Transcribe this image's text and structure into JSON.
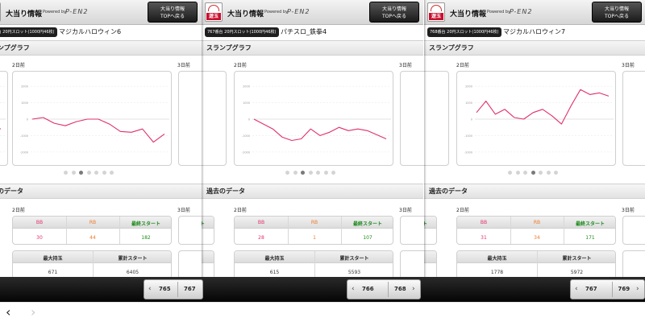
{
  "panels": [
    {
      "machine_badge": "766番台 20円スロット(1000円46枚)",
      "machine_name": "マジカルハロウィン6",
      "days": [
        "2日前",
        "3日前"
      ],
      "table1": {
        "headers": [
          "BB",
          "RB",
          "最終スタート"
        ],
        "values": [
          "30",
          "44",
          "182"
        ]
      },
      "table2": {
        "headers": [
          "最大持玉",
          "累計スタート"
        ],
        "values": [
          "671",
          "6405"
        ]
      },
      "pager": {
        "prev": "765",
        "next": "767"
      },
      "left_clip_start": "ート",
      "active_dot": 2
    },
    {
      "machine_badge": "767番台 20円スロット(1000円46枚)",
      "machine_name": "パチスロ_鉄拳4",
      "days": [
        "2日前",
        "3日前"
      ],
      "table1": {
        "headers": [
          "BB",
          "RB",
          "最終スタート"
        ],
        "values": [
          "28",
          "1",
          "107"
        ]
      },
      "table2": {
        "headers": [
          "最大持玉",
          "累計スタート"
        ],
        "values": [
          "615",
          "5593"
        ]
      },
      "pager": {
        "prev": "766",
        "next": "768"
      },
      "left_clip_start": "ート",
      "active_dot": 2
    },
    {
      "machine_badge": "768番台 20円スロット(1000円46枚)",
      "machine_name": "マジカルハロウィン7",
      "days": [
        "2日前",
        "3日前"
      ],
      "table1": {
        "headers": [
          "BB",
          "RB",
          "最終スタート"
        ],
        "values": [
          "31",
          "34",
          "171"
        ]
      },
      "table2": {
        "headers": [
          "最大持玉",
          "累計スタート"
        ],
        "values": [
          "1778",
          "5972"
        ]
      },
      "pager": {
        "prev": "767",
        "next": "769"
      },
      "left_clip_start": "ート",
      "active_dot": 3
    }
  ],
  "header": {
    "title": "大当り情報",
    "powered": "Powered by",
    "brand": "P-EN2",
    "top_button": "大当り情報\nTOPへ戻る",
    "logo_text": "遊玉"
  },
  "sections": {
    "graph": "スランプグラフ",
    "past": "過去のデータ"
  },
  "graph_axis": [
    "2000",
    "1000",
    "0",
    "-1000",
    "-2000"
  ],
  "colors": {
    "line": "#e0306a",
    "start": "#1a8a1a",
    "rb": "#f07a2a"
  },
  "nav": {
    "back": "‹",
    "forward": "›"
  },
  "chart_data": [
    {
      "type": "line",
      "title": "",
      "xlabel": "",
      "ylabel": "",
      "ylim": [
        -2500,
        2500
      ],
      "series": [
        {
          "values": [
            0,
            100,
            -250,
            -400,
            -150,
            0,
            0,
            -300,
            -750,
            -800,
            -600,
            -1400,
            -900
          ]
        }
      ]
    },
    {
      "type": "line",
      "title": "",
      "xlabel": "",
      "ylabel": "",
      "ylim": [
        -2500,
        2500
      ],
      "series": [
        {
          "values": [
            0,
            -300,
            -600,
            -1100,
            -1300,
            -1200,
            -600,
            -1000,
            -800,
            -500,
            -700,
            -600,
            -700,
            -950,
            -1200
          ]
        }
      ]
    },
    {
      "type": "line",
      "title": "",
      "xlabel": "",
      "ylabel": "",
      "ylim": [
        -2500,
        2500
      ],
      "series": [
        {
          "values": [
            400,
            1100,
            300,
            600,
            100,
            0,
            400,
            600,
            200,
            -300,
            800,
            1800,
            1500,
            1600,
            1400
          ]
        }
      ]
    },
    {
      "type": "line",
      "title": "",
      "xlabel": "",
      "ylabel": "",
      "ylim": [
        -2500,
        2500
      ],
      "series": [
        {
          "values": [
            200,
            -300,
            -600
          ]
        }
      ]
    }
  ]
}
